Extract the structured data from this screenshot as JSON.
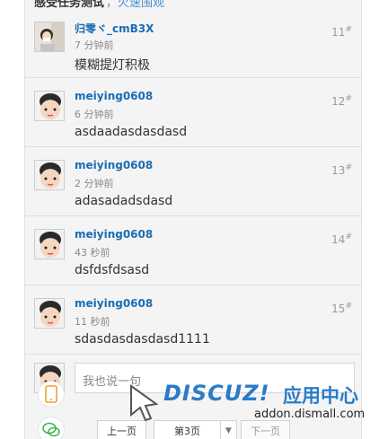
{
  "header_cut": {
    "title": "感受任务测试",
    "link": "，火速围观"
  },
  "posts": [
    {
      "author": "归零ヾ_cmB3X",
      "time": "7 分钟前",
      "content": "模糊提灯积极",
      "floor": "11",
      "floor_mark": "#"
    },
    {
      "author": "meiying0608",
      "time": "6 分钟前",
      "content": "asdaadasdasdasd",
      "floor": "12",
      "floor_mark": "#"
    },
    {
      "author": "meiying0608",
      "time": "2 分钟前",
      "content": "adasadadsdasd",
      "floor": "13",
      "floor_mark": "#"
    },
    {
      "author": "meiying0608",
      "time": "43 秒前",
      "content": "dsfdsfdsasd",
      "floor": "14",
      "floor_mark": "#"
    },
    {
      "author": "meiying0608",
      "time": "11 秒前",
      "content": "sdasdasdasdasd1111",
      "floor": "15",
      "floor_mark": "#"
    }
  ],
  "reply": {
    "placeholder": "我也说一句"
  },
  "pager": {
    "prev": "上一页",
    "current": "第3页",
    "next": "下一页"
  },
  "watermark": {
    "logo": "DISCUZ!",
    "cn": "应用中心",
    "url": "addon.dismall.com"
  },
  "icons": [
    "mobile-icon",
    "wechat-icon",
    "chevron-down-icon"
  ]
}
